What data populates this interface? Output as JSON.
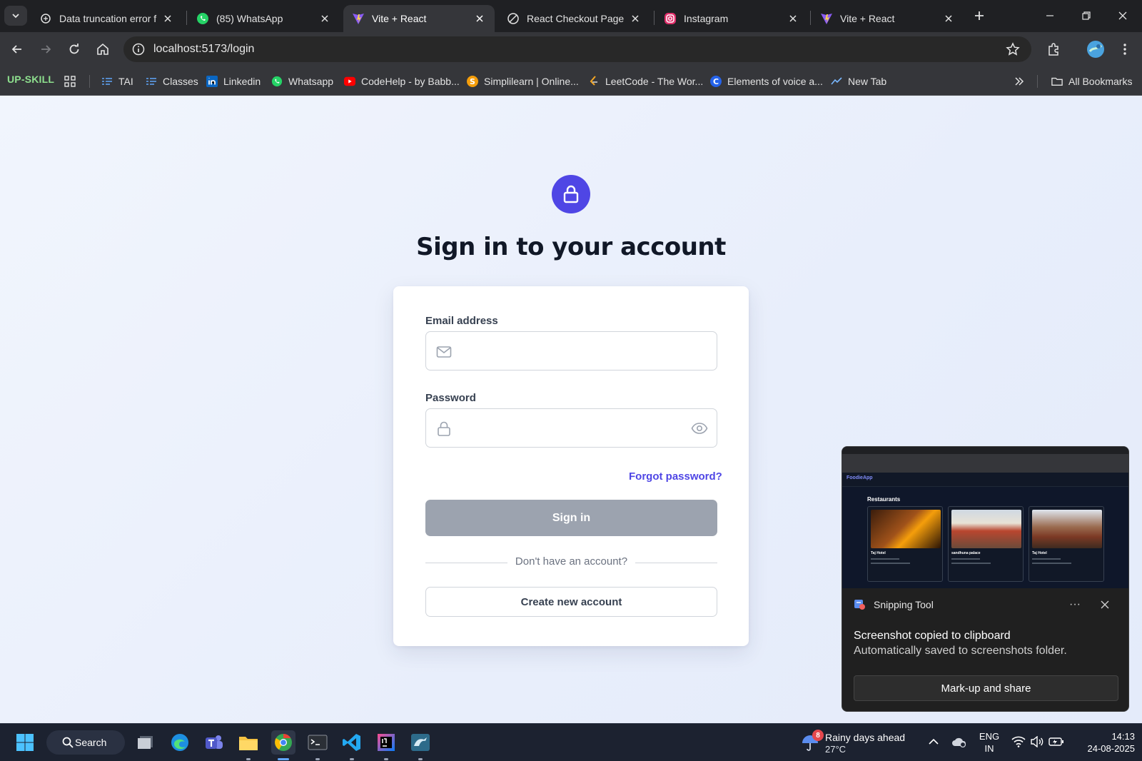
{
  "browser": {
    "tabs": [
      {
        "title": "Data truncation error fix",
        "icon": "chatgpt-icon"
      },
      {
        "title": "(85) WhatsApp",
        "icon": "whatsapp-icon"
      },
      {
        "title": "Vite + React",
        "icon": "vite-icon",
        "active": true
      },
      {
        "title": "React Checkout Page Im",
        "icon": "react-icon"
      },
      {
        "title": "Instagram",
        "icon": "instagram-icon"
      },
      {
        "title": "Vite + React",
        "icon": "vite-icon"
      }
    ],
    "url": "localhost:5173/login",
    "bookmarks": {
      "upskill": "UP-SKILL",
      "items": [
        {
          "label": "TAI",
          "icon": "list-icon"
        },
        {
          "label": "Classes",
          "icon": "list-icon"
        },
        {
          "label": "Linkedin",
          "icon": "linkedin-icon"
        },
        {
          "label": "Whatsapp",
          "icon": "whatsapp-icon"
        },
        {
          "label": "CodeHelp - by Babb...",
          "icon": "youtube-icon"
        },
        {
          "label": "Simplilearn | Online...",
          "icon": "simplilearn-icon"
        },
        {
          "label": "LeetCode - The Wor...",
          "icon": "leetcode-icon"
        },
        {
          "label": "Elements of voice a...",
          "icon": "c-icon"
        },
        {
          "label": "New Tab",
          "icon": "newtab-icon"
        }
      ],
      "all_bookmarks": "All Bookmarks"
    }
  },
  "login": {
    "title": "Sign in to your account",
    "email_label": "Email address",
    "email_value": "",
    "password_label": "Password",
    "password_value": "",
    "forgot": "Forgot password?",
    "signin": "Sign in",
    "divider": "Don't have an account?",
    "create": "Create new account",
    "accent": "#4f46e5"
  },
  "notification": {
    "app": "Snipping Tool",
    "more": "···",
    "title": "Screenshot copied to clipboard",
    "body": "Automatically saved to screenshots folder.",
    "button": "Mark-up and share",
    "thumb": {
      "logo": "FoodieApp",
      "heading": "Restaurants",
      "cards": [
        "Taj Hotel",
        "sandhuna palace",
        "Taj Hotel"
      ]
    }
  },
  "taskbar": {
    "search": "Search",
    "weather_badge": "8",
    "weather_line1": "Rainy days ahead",
    "weather_line2": "27°C",
    "lang1": "ENG",
    "lang2": "IN",
    "time": "14:13",
    "date": "24-08-2025"
  }
}
